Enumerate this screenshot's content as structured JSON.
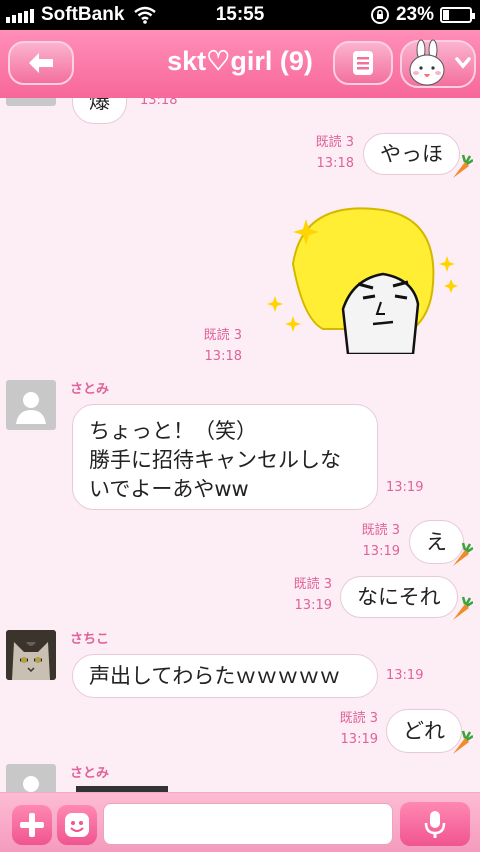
{
  "status_bar": {
    "carrier": "SoftBank",
    "time": "15:55",
    "battery": "23%",
    "battery_fraction": 0.23
  },
  "header": {
    "title": "skt♡girl (9)"
  },
  "messages": {
    "partial_top": {
      "text": "爆",
      "time": "13:18"
    },
    "m1": {
      "text": "やっほ",
      "read": "既読 3",
      "time": "13:18"
    },
    "m2": {
      "read": "既読 3",
      "time": "13:18"
    },
    "m3": {
      "sender": "さとみ",
      "line1": "ちょっと！（笑）",
      "line2": "勝手に招待キャンセルしな",
      "line3": "いでよーあやww",
      "time": "13:19"
    },
    "m4": {
      "text": "え",
      "read": "既読 3",
      "time": "13:19"
    },
    "m5": {
      "text": "なにそれ",
      "read": "既読 3",
      "time": "13:19"
    },
    "m6": {
      "sender": "さちこ",
      "text": "声出してわらたｗｗｗｗｗ",
      "time": "13:19"
    },
    "m7": {
      "text": "どれ",
      "read": "既読 3",
      "time": "13:19"
    },
    "m8": {
      "sender": "さとみ"
    }
  },
  "input": {
    "placeholder": ""
  },
  "colors": {
    "accent": "#f7679a",
    "meta_pink": "#e0629a",
    "background": "#fdeef5"
  }
}
